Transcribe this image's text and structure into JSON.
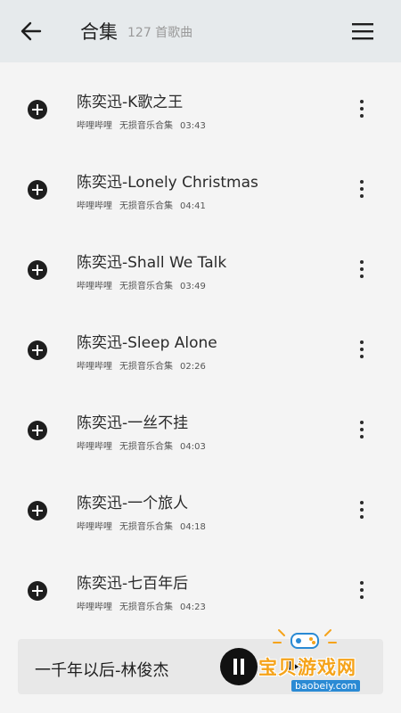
{
  "header": {
    "title": "合集",
    "subtitle": "127 首歌曲"
  },
  "songs": [
    {
      "title": "陈奕迅-K歌之王",
      "source": "哔哩哔哩",
      "album": "无损音乐合集",
      "duration": "03:43"
    },
    {
      "title": "陈奕迅-Lonely Christmas",
      "source": "哔哩哔哩",
      "album": "无损音乐合集",
      "duration": "04:41"
    },
    {
      "title": "陈奕迅-Shall We Talk",
      "source": "哔哩哔哩",
      "album": "无损音乐合集",
      "duration": "03:49"
    },
    {
      "title": "陈奕迅-Sleep Alone",
      "source": "哔哩哔哩",
      "album": "无损音乐合集",
      "duration": "02:26"
    },
    {
      "title": "陈奕迅-一丝不挂",
      "source": "哔哩哔哩",
      "album": "无损音乐合集",
      "duration": "04:03"
    },
    {
      "title": "陈奕迅-一个旅人",
      "source": "哔哩哔哩",
      "album": "无损音乐合集",
      "duration": "04:18"
    },
    {
      "title": "陈奕迅-七百年后",
      "source": "哔哩哔哩",
      "album": "无损音乐合集",
      "duration": "04:23"
    }
  ],
  "player": {
    "now_playing": "一千年以后-林俊杰"
  },
  "watermark": {
    "text": "宝贝游戏网",
    "url": "baobeiy.com"
  },
  "icons": {
    "back": "arrow-left-icon",
    "menu": "hamburger-menu-icon",
    "add": "add-circle-icon",
    "more": "more-vertical-icon",
    "pause": "pause-icon",
    "next": "skip-next-icon"
  }
}
